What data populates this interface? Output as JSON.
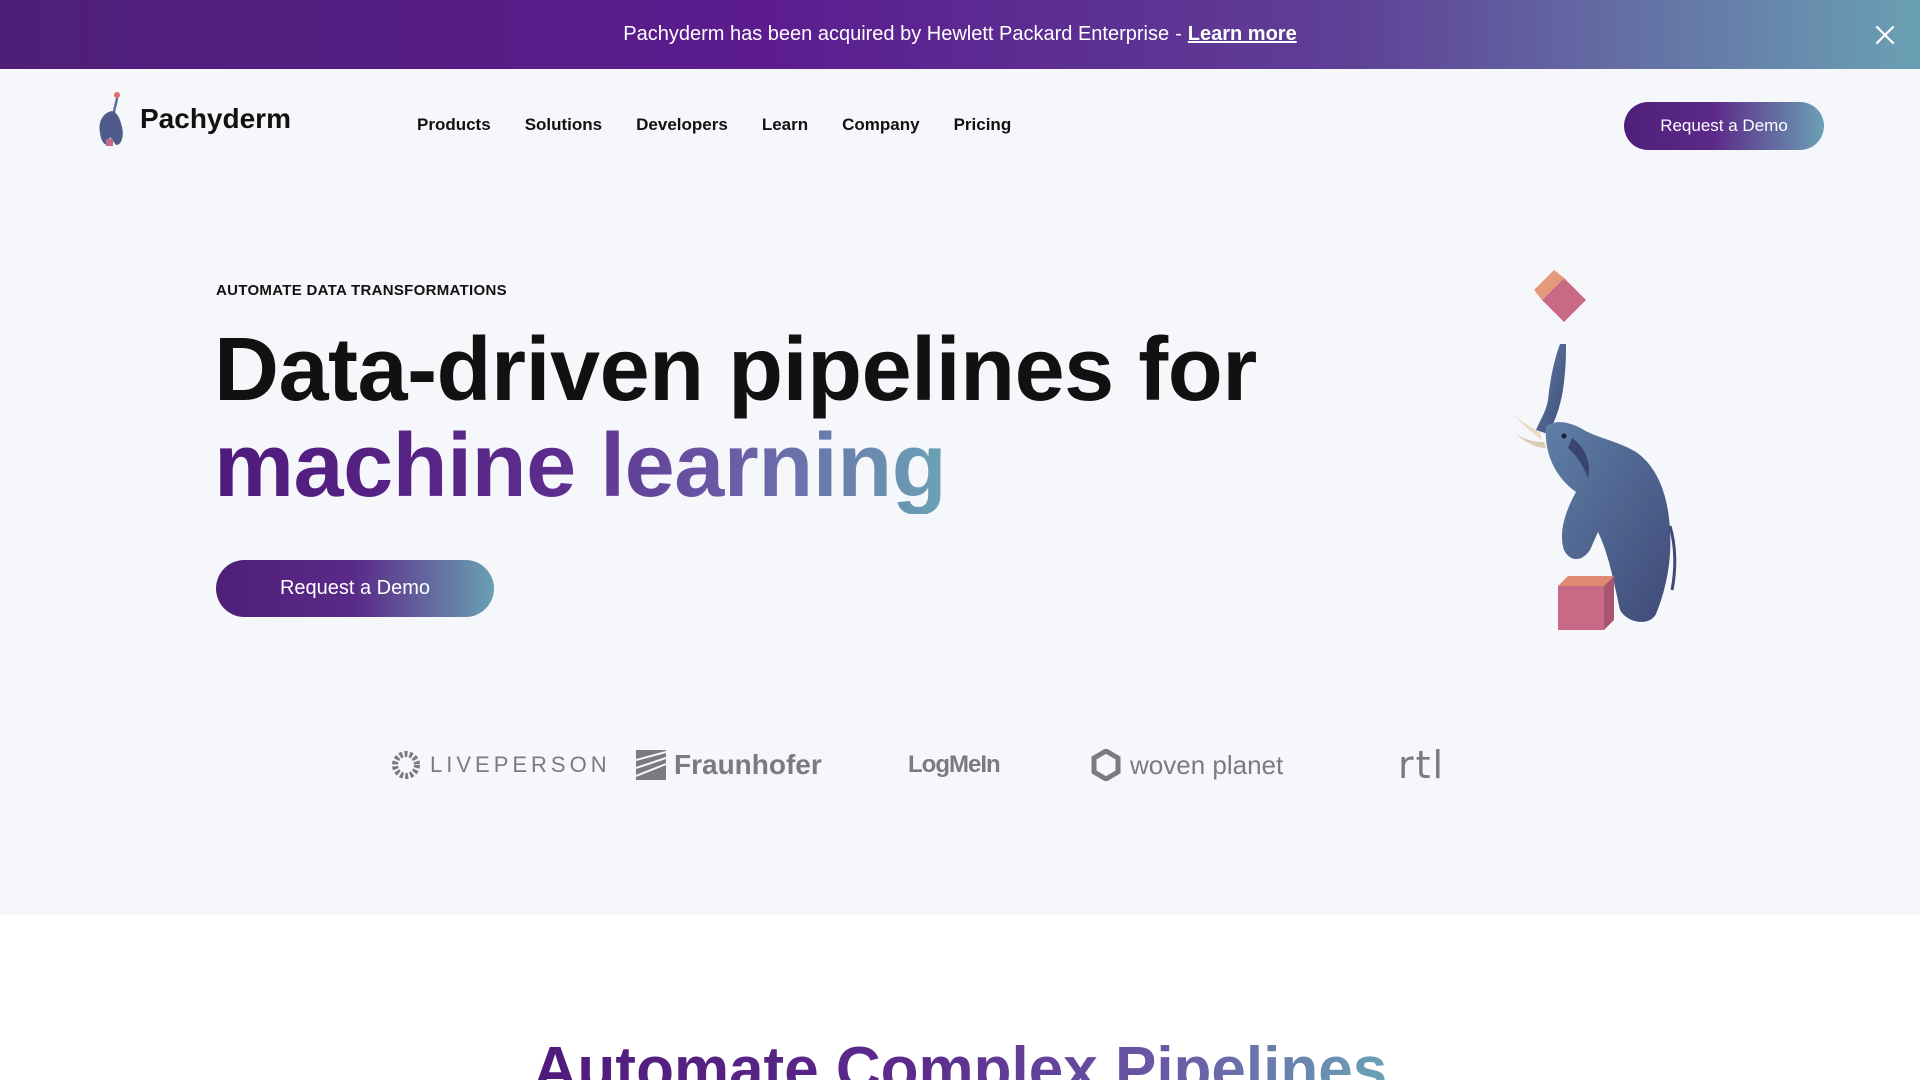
{
  "banner": {
    "text": "Pachyderm has been acquired by Hewlett Packard Enterprise",
    "separator": "-",
    "link_label": "Learn more"
  },
  "header": {
    "logo_text": "Pachyderm",
    "nav": [
      "Products",
      "Solutions",
      "Developers",
      "Learn",
      "Company",
      "Pricing"
    ],
    "cta_label": "Request a Demo"
  },
  "hero": {
    "eyebrow": "AUTOMATE DATA TRANSFORMATIONS",
    "title_line1": "Data-driven pipelines for",
    "title_line2": "machine learning",
    "cta_label": "Request a Demo"
  },
  "logos": {
    "liveperson": "LIVEPERSON",
    "fraunhofer": "Fraunhofer",
    "logmein": "LogMeIn",
    "woven_planet": "woven planet",
    "rtl": "rtl"
  },
  "section": {
    "title": "Automate Complex Pipelines"
  },
  "colors": {
    "brand_purple": "#4e1f78",
    "brand_teal": "#6aa0b3",
    "background": "#f6f7fb"
  }
}
